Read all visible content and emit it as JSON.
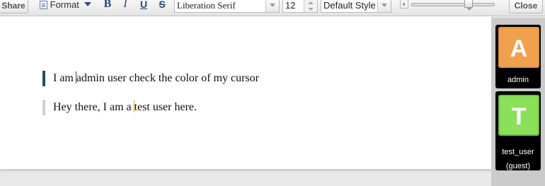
{
  "toolbar": {
    "share_label": "Share",
    "format_label": "Format",
    "bold_glyph": "B",
    "italic_glyph": "I",
    "underline_glyph": "U",
    "strike_glyph": "S",
    "font_family_value": "Liberation Serif",
    "font_size_value": "12",
    "paragraph_style_value": "Default Style",
    "zoom_level": 0.7,
    "close_label": "Close"
  },
  "document": {
    "paragraphs": [
      {
        "before": "I am ",
        "after": "admin user check the color of my cursor",
        "caret_color": "#1f4f6a",
        "gutter_color": "#1f4f6a"
      },
      {
        "before": "Hey there, I am a ",
        "after": "test user here.",
        "caret_color": "#e0a02a",
        "gutter_color": "#c9d2da"
      }
    ]
  },
  "users": [
    {
      "initial": "A",
      "name": "admin",
      "role": "",
      "color": "#f0a14e"
    },
    {
      "initial": "T",
      "name": "test_user",
      "role": "(guest)",
      "color": "#8be05a"
    }
  ]
}
